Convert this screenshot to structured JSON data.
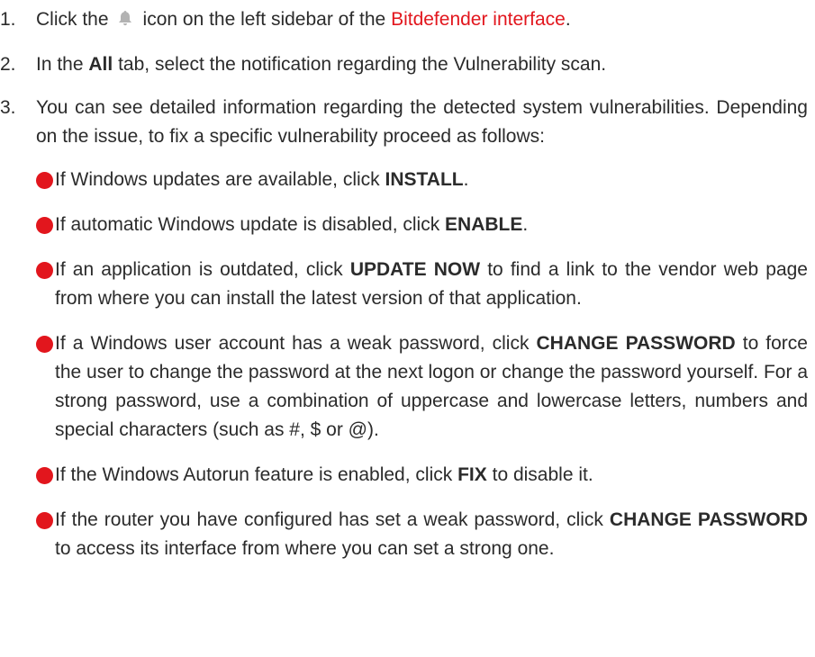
{
  "steps": [
    {
      "number": "1.",
      "text_before": "Click the",
      "icon": "bell-icon",
      "text_middle": "icon on the left sidebar of the",
      "link_text": "Bitdefender interface",
      "text_after": "."
    },
    {
      "number": "2.",
      "text_before": "In the",
      "bold": "All",
      "text_after": "tab, select the notification regarding the Vulnerability scan."
    },
    {
      "number": "3.",
      "text": "You can see detailed information regarding the detected system vulnerabilities. Depending on the issue, to fix a specific vulnerability proceed as follows:"
    }
  ],
  "bullets": [
    {
      "before": "If Windows updates are available, click",
      "bold": "INSTALL",
      "after": "."
    },
    {
      "before": "If automatic Windows update is disabled, click",
      "bold": "ENABLE",
      "after": "."
    },
    {
      "before": "If an application is outdated, click",
      "bold": "UPDATE NOW",
      "after": "to find a link to the vendor web page from where you can install the latest version of that application."
    },
    {
      "before": "If a Windows user account has a weak password, click",
      "bold": "CHANGE PASSWORD",
      "after": "to force the user to change the password at the next logon or change the password yourself. For a strong password, use a combination of uppercase and lowercase letters, numbers and special characters (such as #, $ or @)."
    },
    {
      "before": "If the Windows Autorun feature is enabled, click",
      "bold": "FIX",
      "after": "to disable it."
    },
    {
      "before": "If the router you have configured has set a weak password, click",
      "bold": "CHANGE PASSWORD",
      "after": "to access its interface from where you can set a strong one."
    }
  ],
  "colors": {
    "accent": "#e2161d",
    "text": "#2b2b2b",
    "icon": "#b3b3b3"
  }
}
